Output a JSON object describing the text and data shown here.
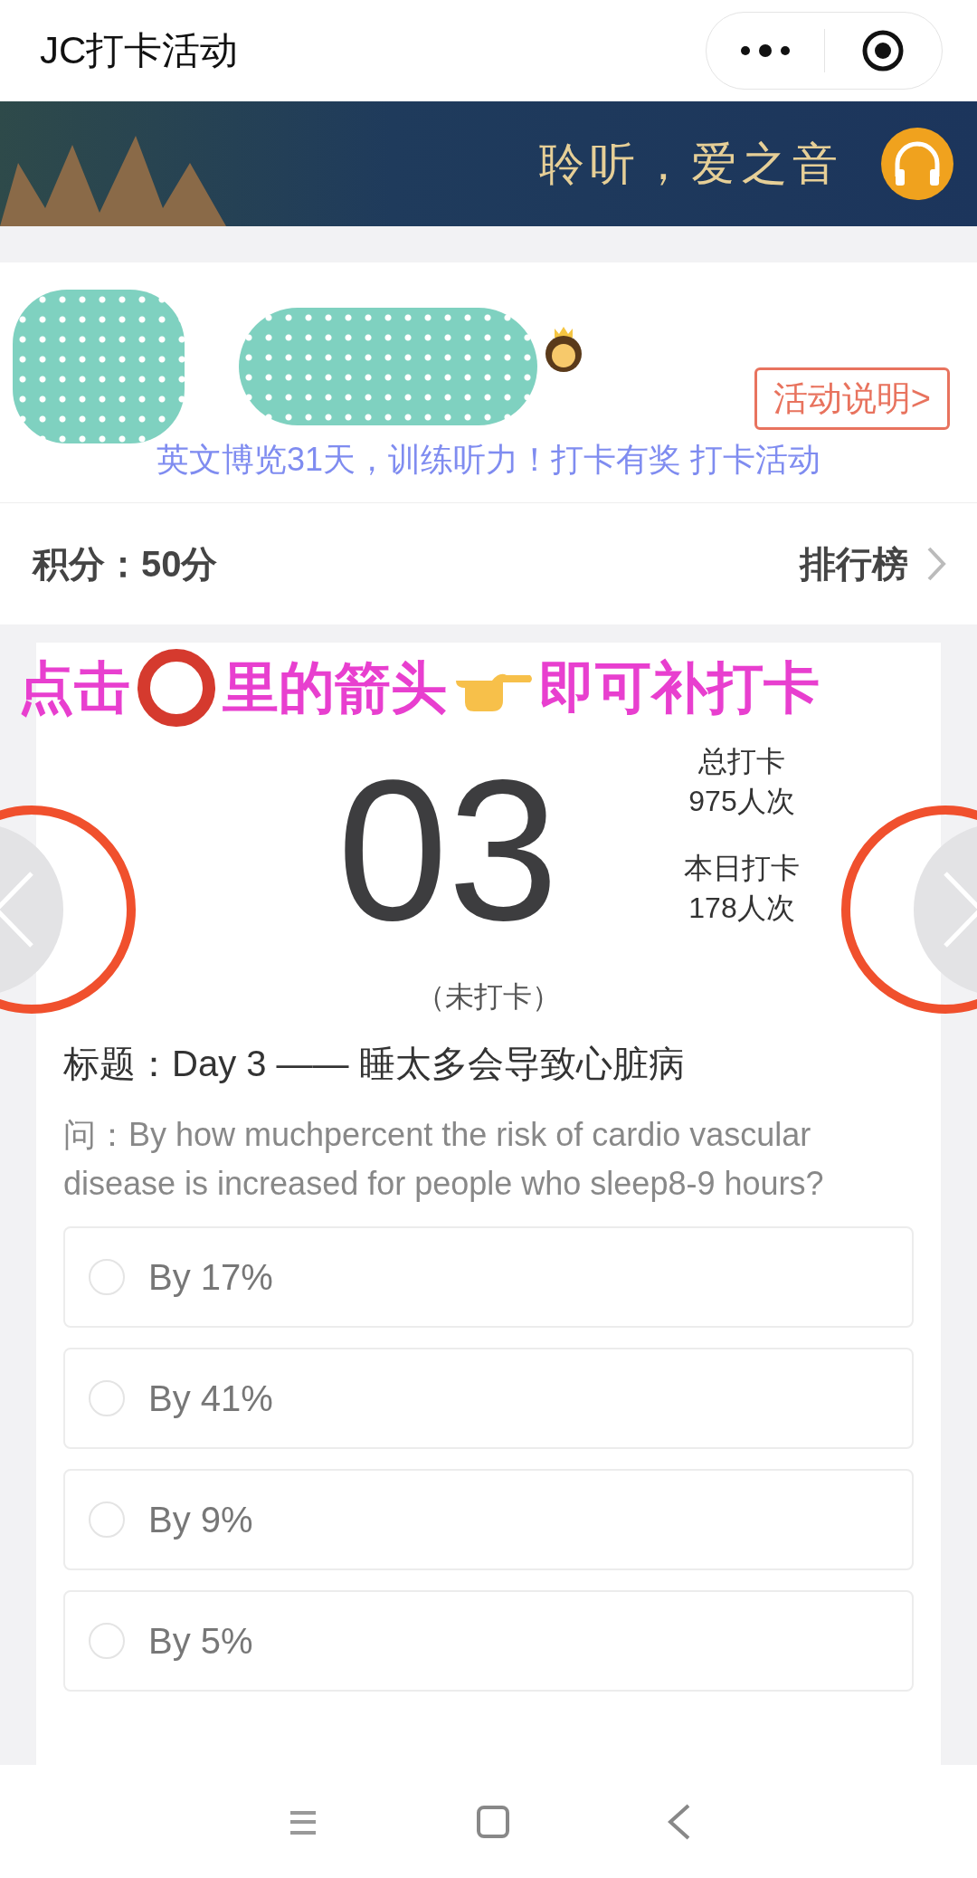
{
  "nav": {
    "title": "JC打卡活动"
  },
  "banner": {
    "text": "聆听，爱之音"
  },
  "profile": {
    "info_button": "活动说明>",
    "slogan": "英文博览31天，训练听力！打卡有奖 打卡活动"
  },
  "score": {
    "label": "积分：50分",
    "ranking": "排行榜"
  },
  "annotation": [
    {
      "kind": "text",
      "text": "点击"
    },
    {
      "kind": "ring"
    },
    {
      "kind": "text",
      "text": "里的箭头"
    },
    {
      "kind": "hand"
    },
    {
      "kind": "text",
      "text": "即可补打卡"
    }
  ],
  "day": {
    "number": "03",
    "status": "（未打卡）"
  },
  "stats": [
    {
      "label": "总打卡",
      "value": "975人次"
    },
    {
      "label": "本日打卡",
      "value": "178人次"
    }
  ],
  "title": "标题：Day 3 —— 睡太多会导致心脏病",
  "question": "问：By how muchpercent the risk of cardio vascular disease is increased for people who sleep8-9 hours?",
  "options": [
    {
      "label": "By 17%",
      "selected": false
    },
    {
      "label": "By 41%",
      "selected": false
    },
    {
      "label": "By 9%",
      "selected": false
    },
    {
      "label": "By 5%",
      "selected": false
    }
  ]
}
